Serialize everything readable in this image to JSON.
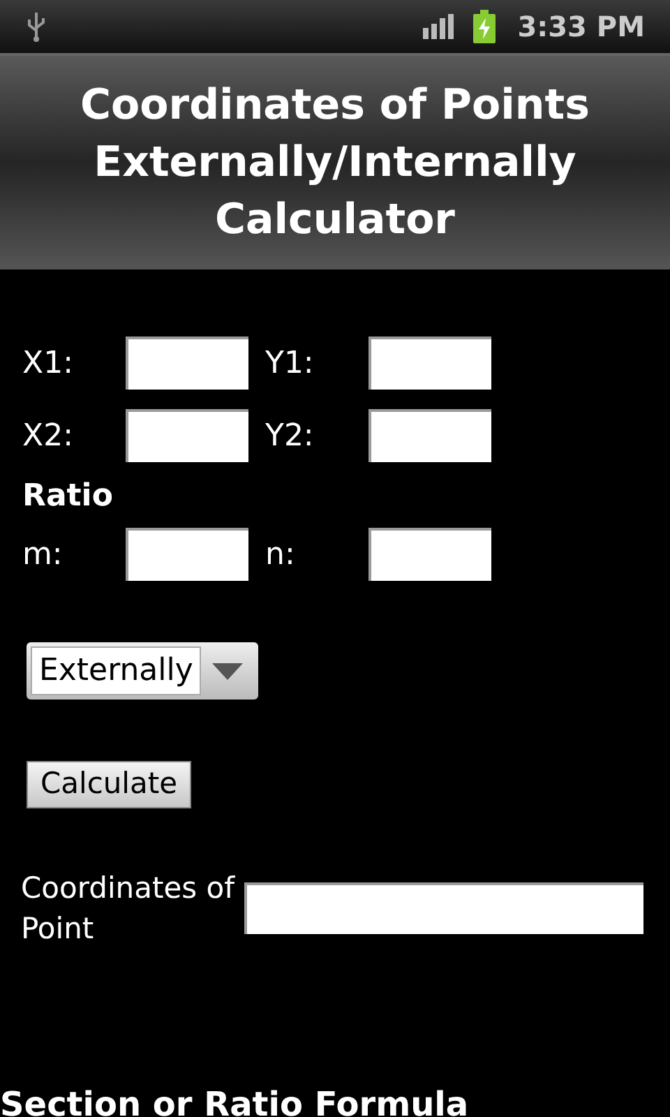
{
  "status_bar": {
    "time": "3:33 PM"
  },
  "title": "Coordinates of Points Externally/Internally Calculator",
  "point_rows": [
    {
      "fields": [
        {
          "label": "X1:"
        },
        {
          "label": "Y1:"
        }
      ]
    },
    {
      "fields": [
        {
          "label": "X2:"
        },
        {
          "label": "Y2:"
        }
      ]
    }
  ],
  "ratio_heading": "Ratio",
  "ratio_row": {
    "fields": [
      {
        "label": "m:"
      },
      {
        "label": "n:"
      }
    ]
  },
  "division_select": {
    "value": "Externally"
  },
  "calculate_button": "Calculate",
  "result": {
    "label": "Coordinates of Point"
  },
  "section_heading": "Section or Ratio Formula"
}
